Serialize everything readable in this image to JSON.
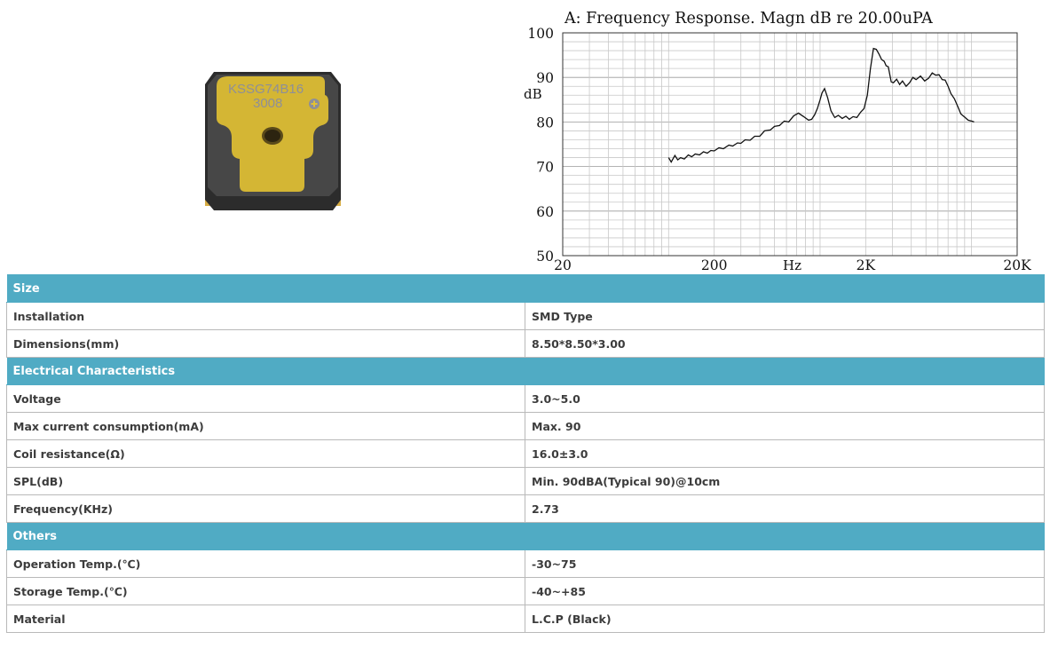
{
  "product": {
    "marking_line1": "KSSG74B16",
    "marking_line2": "3008"
  },
  "chart_data": {
    "type": "line",
    "title": "A: Frequency Response. Magn dB re 20.00uPA",
    "ylabel": "dB",
    "xlabel": "Hz",
    "x_scale": "log",
    "xlim": [
      20,
      20000
    ],
    "ylim": [
      50,
      100
    ],
    "x_ticks": [
      {
        "value": 20,
        "label": "20"
      },
      {
        "value": 200,
        "label": "200"
      },
      {
        "value": 2000,
        "label": "2K"
      },
      {
        "value": 20000,
        "label": "20K"
      }
    ],
    "y_ticks": [
      {
        "value": 100,
        "label": "100"
      },
      {
        "value": 90,
        "label": "90"
      },
      {
        "value": 80,
        "label": "80"
      },
      {
        "value": 70,
        "label": "70"
      },
      {
        "value": 60,
        "label": "60"
      },
      {
        "value": 50,
        "label": "50"
      }
    ],
    "grid": true,
    "series": [
      {
        "x": [
          100,
          104,
          110,
          115,
          120,
          127,
          135,
          142,
          150,
          160,
          170,
          180,
          190,
          200,
          215,
          230,
          250,
          265,
          285,
          300,
          320,
          345,
          370,
          400,
          430,
          470,
          500,
          540,
          580,
          620,
          670,
          720,
          780,
          840,
          880,
          920,
          960,
          1000,
          1030,
          1070,
          1120,
          1180,
          1250,
          1320,
          1400,
          1480,
          1560,
          1650,
          1750,
          1850,
          1950,
          2050,
          2150,
          2250,
          2350,
          2450,
          2550,
          2650,
          2730,
          2820,
          2950,
          3050,
          3200,
          3350,
          3500,
          3700,
          3900,
          4100,
          4300,
          4600,
          4900,
          5200,
          5500,
          5800,
          6100,
          6400,
          6700,
          7000,
          7300,
          7700,
          8100,
          8500,
          9000,
          9500,
          10000,
          10400
        ],
        "y": [
          72,
          71,
          72.5,
          71.5,
          72,
          71.7,
          72.6,
          72.2,
          72.8,
          72.6,
          73.3,
          73,
          73.6,
          73.5,
          74.2,
          74,
          74.8,
          74.6,
          75.3,
          75.2,
          76,
          75.9,
          76.8,
          76.8,
          78,
          78.2,
          79,
          79.2,
          80.2,
          80,
          81.4,
          82,
          81.2,
          80.4,
          80.6,
          81.6,
          83,
          85,
          86.5,
          87.5,
          85.5,
          82.5,
          81,
          81.5,
          80.8,
          81.3,
          80.6,
          81.2,
          81,
          82.2,
          83,
          86,
          92,
          96.5,
          96.3,
          95.2,
          94,
          93.6,
          92.6,
          92.4,
          89,
          88.8,
          89.6,
          88.4,
          89.2,
          88,
          88.8,
          90,
          89.5,
          90.3,
          89.2,
          89.8,
          91,
          90.5,
          90.6,
          89.5,
          89.4,
          88,
          86.4,
          85.2,
          83.5,
          81.8,
          81.1,
          80.4,
          80.2,
          80
        ]
      }
    ]
  },
  "spec_table": {
    "rows": [
      {
        "kind": "section",
        "label": "Size"
      },
      {
        "kind": "row",
        "label": "Installation",
        "value": "SMD Type"
      },
      {
        "kind": "row",
        "label": "Dimensions(mm)",
        "value": "8.50*8.50*3.00"
      },
      {
        "kind": "section",
        "label": "Electrical Characteristics"
      },
      {
        "kind": "row",
        "label": "Voltage",
        "value": "3.0~5.0"
      },
      {
        "kind": "row",
        "label": "Max current consumption(mA)",
        "value": "Max. 90"
      },
      {
        "kind": "row",
        "label": "Coil resistance(Ω)",
        "value": "16.0±3.0"
      },
      {
        "kind": "row",
        "label": "SPL(dB)",
        "value": "Min. 90dBA(Typical 90)@10cm"
      },
      {
        "kind": "row",
        "label": "Frequency(KHz)",
        "value": "2.73"
      },
      {
        "kind": "section",
        "label": "Others"
      },
      {
        "kind": "row",
        "label": "Operation Temp.(℃)",
        "value": "-30~75"
      },
      {
        "kind": "row",
        "label": "Storage Temp.(℃)",
        "value": "-40~+85"
      },
      {
        "kind": "row",
        "label": "Material",
        "value": "L.C.P (Black)"
      }
    ]
  },
  "colors": {
    "section_header": "#50abc4",
    "buzzer_body": "#3a3a3a",
    "label_film": "#e6c434",
    "curve": "#111111"
  }
}
